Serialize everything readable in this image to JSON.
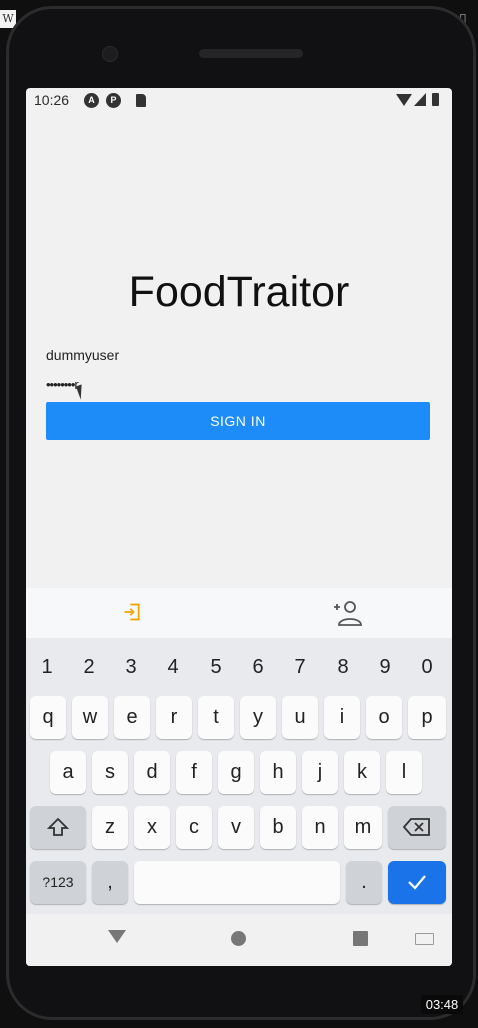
{
  "status_bar": {
    "time": "10:26",
    "icons": [
      "a-icon",
      "p-icon",
      "sd-card-icon",
      "wifi-icon",
      "signal-icon",
      "battery-icon"
    ]
  },
  "app": {
    "title": "FoodTraitor",
    "username_value": "dummyuser",
    "password_mask": "••••••••r",
    "sign_in_label": "SIGN IN",
    "accent_color": "#1d8cf8"
  },
  "keyboard_top": {
    "icons": [
      "login-icon",
      "add-person-icon"
    ],
    "login_icon_color": "#f2a300"
  },
  "keyboard": {
    "numbers": [
      "1",
      "2",
      "3",
      "4",
      "5",
      "6",
      "7",
      "8",
      "9",
      "0"
    ],
    "row1": [
      "q",
      "w",
      "e",
      "r",
      "t",
      "y",
      "u",
      "i",
      "o",
      "p"
    ],
    "row2": [
      "a",
      "s",
      "d",
      "f",
      "g",
      "h",
      "j",
      "k",
      "l"
    ],
    "row3": [
      "z",
      "x",
      "c",
      "v",
      "b",
      "n",
      "m"
    ],
    "symbols_label": "?123",
    "comma": ",",
    "period": ".",
    "enter_icon": "checkmark-icon",
    "enter_color": "#1a73e8"
  },
  "nav_bar": {
    "icons": [
      "back-icon",
      "home-icon",
      "recents-icon",
      "keyboard-switch-icon"
    ]
  },
  "overlay": {
    "corner_badge": "W",
    "video_time": "03:48"
  }
}
